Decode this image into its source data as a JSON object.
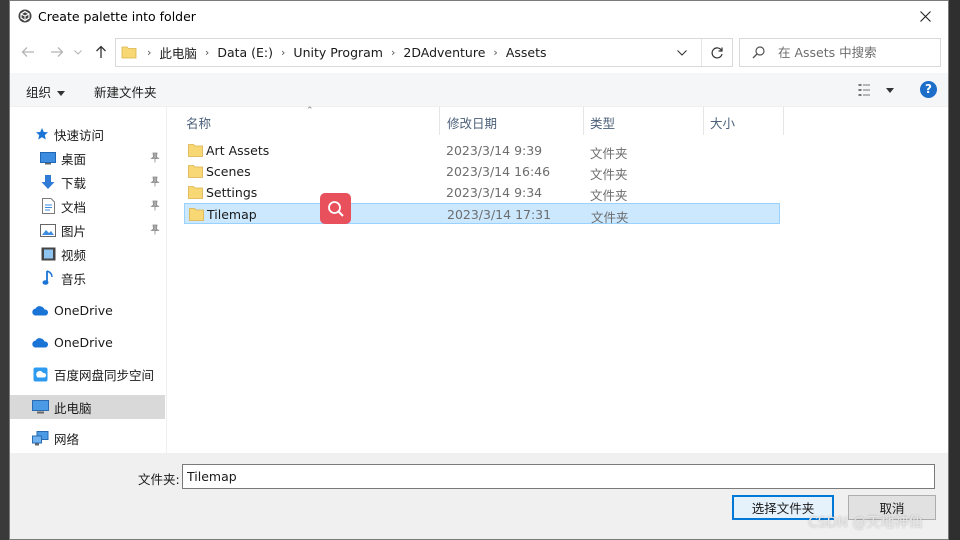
{
  "window": {
    "title": "Create palette into folder"
  },
  "address": {
    "crumbs": [
      "此电脑",
      "Data (E:)",
      "Unity Program",
      "2DAdventure",
      "Assets"
    ]
  },
  "search": {
    "placeholder": "在 Assets 中搜索"
  },
  "commands": {
    "organize": "组织",
    "new_folder": "新建文件夹"
  },
  "help": {
    "label": "?"
  },
  "nav": {
    "items": [
      {
        "label": "快速访问",
        "icon": "star-icon"
      },
      {
        "label": "桌面",
        "icon": "desktop-icon",
        "pinned": true
      },
      {
        "label": "下载",
        "icon": "download-icon",
        "pinned": true
      },
      {
        "label": "文档",
        "icon": "document-icon",
        "pinned": true
      },
      {
        "label": "图片",
        "icon": "picture-icon",
        "pinned": true
      },
      {
        "label": "视频",
        "icon": "video-icon"
      },
      {
        "label": "音乐",
        "icon": "music-icon"
      },
      {
        "label": "OneDrive",
        "icon": "cloud-icon"
      },
      {
        "label": "OneDrive",
        "icon": "cloud-icon"
      },
      {
        "label": "百度网盘同步空间",
        "icon": "baidu-netdisk-icon"
      },
      {
        "label": "此电脑",
        "icon": "computer-icon",
        "selected": true
      },
      {
        "label": "网络",
        "icon": "network-icon"
      }
    ]
  },
  "columns": {
    "name": "名称",
    "date": "修改日期",
    "type": "类型",
    "size": "大小"
  },
  "files": [
    {
      "name": "Art Assets",
      "date": "2023/3/14 9:39",
      "type": "文件夹"
    },
    {
      "name": "Scenes",
      "date": "2023/3/14 16:46",
      "type": "文件夹"
    },
    {
      "name": "Settings",
      "date": "2023/3/14 9:34",
      "type": "文件夹"
    },
    {
      "name": "Tilemap",
      "date": "2023/3/14 17:31",
      "type": "文件夹",
      "selected": true
    }
  ],
  "bottom": {
    "folder_label": "文件夹:",
    "folder_value": "Tilemap",
    "select_button": "选择文件夹",
    "cancel_button": "取消"
  },
  "watermark": "CSDN @天地神仙",
  "colors": {
    "accent": "#0078d7",
    "selection": "#cce8ff",
    "folder": "#f8d775",
    "help": "#1c6ec9",
    "badge": "#e8505b"
  }
}
